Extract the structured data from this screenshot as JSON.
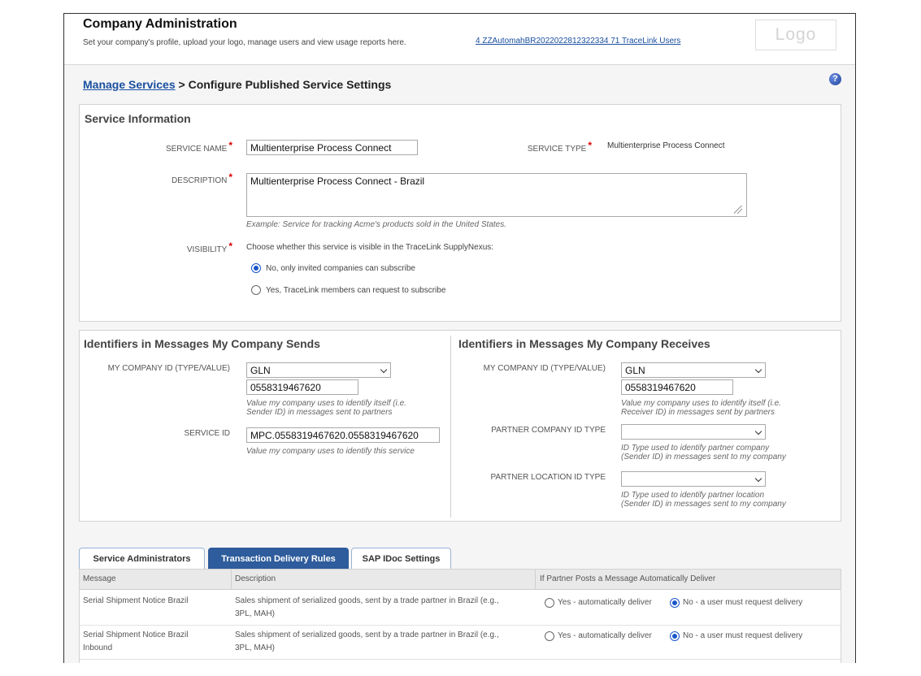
{
  "header": {
    "title": "Company Administration",
    "subtitle": "Set your company's profile, upload your logo, manage users and view usage reports here.",
    "users_link": "4 ZZAutomahBR2022022812322334 71 TraceLink Users",
    "logo_text": "Logo"
  },
  "breadcrumb": {
    "parent": "Manage Services",
    "separator": " > ",
    "current": "Configure Published Service Settings"
  },
  "help_glyph": "?",
  "service_info": {
    "title": "Service Information",
    "service_name_label": "SERVICE NAME",
    "service_name_value": "Multienterprise Process Connect",
    "service_type_label": "SERVICE TYPE",
    "service_type_value": "Multienterprise Process Connect",
    "description_label": "DESCRIPTION",
    "description_value": "Multienterprise Process Connect - Brazil",
    "description_hint": "Example: Service for tracking Acme's products sold in the United States.",
    "visibility_label": "VISIBILITY",
    "visibility_prompt": "Choose whether this service is visible in the TraceLink SupplyNexus:",
    "visibility_options": [
      {
        "label": "No, only invited companies can subscribe",
        "selected": true
      },
      {
        "label": "Yes, TraceLink members can request to subscribe",
        "selected": false
      }
    ],
    "required_mark": "*"
  },
  "sends": {
    "title": "Identifiers in Messages My Company Sends",
    "company_id_label": "MY COMPANY ID (TYPE/VALUE)",
    "company_id_type": "GLN",
    "company_id_value": "0558319467620",
    "company_id_hint_1": "Value my company uses to identify itself (i.e.",
    "company_id_hint_2": "Sender ID) in messages sent to partners",
    "service_id_label": "SERVICE ID",
    "service_id_value": "MPC.0558319467620.0558319467620",
    "service_id_hint": "Value my company uses to identify this service"
  },
  "receives": {
    "title": "Identifiers in Messages My Company Receives",
    "company_id_label": "MY COMPANY ID (TYPE/VALUE)",
    "company_id_type": "GLN",
    "company_id_value": "0558319467620",
    "company_id_hint_1": "Value my company uses to identify itself (i.e.",
    "company_id_hint_2": "Receiver ID) in messages sent by partners",
    "partner_company_label": "PARTNER COMPANY ID TYPE",
    "partner_company_value": "",
    "partner_company_hint_1": "ID Type used to identify partner company",
    "partner_company_hint_2": "(Sender ID) in messages sent to my company",
    "partner_location_label": "PARTNER LOCATION ID TYPE",
    "partner_location_value": "",
    "partner_location_hint_1": "ID Type used to identify partner location",
    "partner_location_hint_2": "(Sender ID) in messages sent to my company"
  },
  "tabs": [
    {
      "label": "Service Administrators",
      "active": false
    },
    {
      "label": "Transaction Delivery Rules",
      "active": true
    },
    {
      "label": "SAP IDoc Settings",
      "active": false
    }
  ],
  "table": {
    "columns": [
      "Message",
      "Description",
      "If Partner Posts a Message Automatically Deliver"
    ],
    "rows": [
      {
        "message_1": "Serial Shipment Notice Brazil",
        "message_2": "",
        "description_1": "Sales shipment of serialized goods, sent by a trade partner in Brazil (e.g.,",
        "description_2": "3PL, MAH)",
        "yes_label": "Yes - automatically deliver",
        "no_label": "No - a user must request delivery",
        "selected": "no"
      },
      {
        "message_1": "Serial Shipment Notice Brazil",
        "message_2": "Inbound",
        "description_1": "Sales shipment of serialized goods, sent by a trade partner in Brazil (e.g.,",
        "description_2": "3PL, MAH)",
        "yes_label": "Yes - automatically deliver",
        "no_label": "No - a user must request delivery",
        "selected": "no"
      }
    ]
  }
}
